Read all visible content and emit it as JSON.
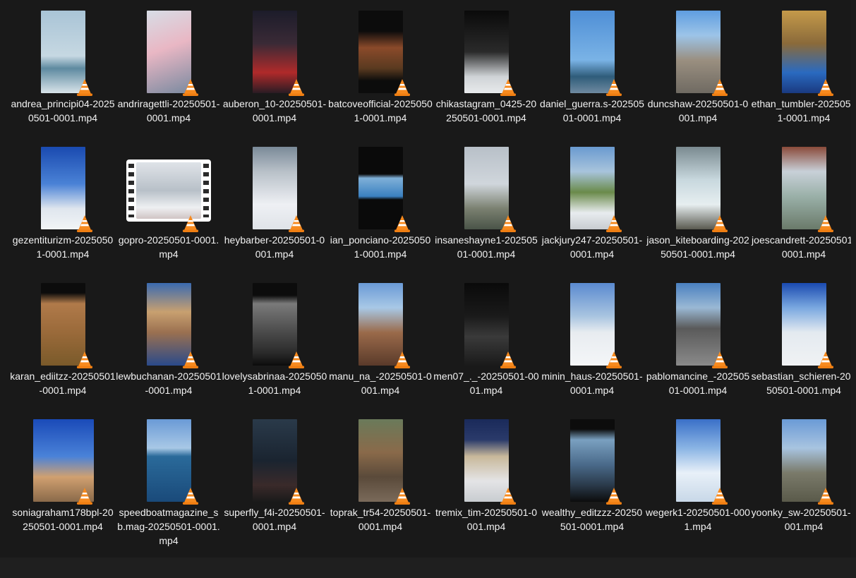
{
  "files": [
    {
      "name": "andrea_principi04-20250501-0001.mp4",
      "bg": "linear-gradient(180deg,#a9c4d6 0%,#c6d8e2 55%,#5e8aa0 70%,#d9e4ea 100%)"
    },
    {
      "name": "andriragettli-20250501-0001.mp4",
      "bg": "linear-gradient(160deg,#d7dde6 0%,#e9b7c4 45%,#7a8aa0 100%)"
    },
    {
      "name": "auberon_10-20250501-0001.mp4",
      "bg": "linear-gradient(180deg,#1c1c2a 0%,#3a2a36 40%,#b02a2a 75%,#2a1c24 100%)"
    },
    {
      "name": "batcoveofficial-20250501-0001.mp4",
      "bg": "linear-gradient(180deg,#0c0c0c 0%,#0c0c0c 25%,#8a4a2a 45%,#5a3a20 70%,#0c0c0c 85%)"
    },
    {
      "name": "chikastagram_0425-20250501-0001.mp4",
      "bg": "linear-gradient(180deg,#0a0a0a 0%,#2a2a2a 50%,#cfd3d6 80%,#e8eaec 100%)"
    },
    {
      "name": "daniel_guerra.s-20250501-0001.mp4",
      "bg": "linear-gradient(180deg,#4f8fd6 0%,#7ab3e6 60%,#2f5c7a 80%,#6f8aa0 100%)"
    },
    {
      "name": "duncshaw-20250501-0001.mp4",
      "bg": "linear-gradient(180deg,#5f9de0 0%,#9cc4e8 30%,#9a8f80 60%,#6f6a62 100%)"
    },
    {
      "name": "ethan_tumbler-20250501-0001.mp4",
      "bg": "linear-gradient(180deg,#c59a4a 0%,#8a6a3a 40%,#2a6ac0 75%,#1a3a80 100%)"
    },
    {
      "name": "gezentiturizm-20250501-0001.mp4",
      "bg": "linear-gradient(180deg,#1a4ab0 0%,#4a82d6 45%,#dfe6ee 75%,#f2f4f6 100%)"
    },
    {
      "name": "gopro-20250501-0001.mp4",
      "bg": "linear-gradient(180deg,#dfe3e8 0%,#b8c0c8 50%,#eef0f2 80%,#d0c4c4 100%)",
      "film": true
    },
    {
      "name": "heybarber-20250501-0001.mp4",
      "bg": "linear-gradient(180deg,#7a8a98 0%,#b8c0c8 30%,#eef0f4 70%,#dfe3e8 100%)"
    },
    {
      "name": "ian_ponciano-20250501-0001.mp4",
      "bg": "linear-gradient(180deg,#0a0a0a 0%,#0a0a0a 33%,#7fb0d8 38%,#3a80c0 60%,#0a0a0a 64%,#0a0a0a 100%)"
    },
    {
      "name": "insaneshayne1-20250501-0001.mp4",
      "bg": "linear-gradient(180deg,#b8c0c8 0%,#d0d6dc 45%,#7a8070 75%,#4a5448 100%)"
    },
    {
      "name": "jackjury247-20250501-0001.mp4",
      "bg": "linear-gradient(180deg,#6a9ad0 0%,#a8c4dc 30%,#6a8a4a 55%,#e8ecef 80%,#c8ccd0 100%)"
    },
    {
      "name": "jason_kiteboarding-20250501-0001.mp4",
      "bg": "linear-gradient(180deg,#7a8a90 0%,#c8d8de 40%,#e6eef0 70%,#5a5a50 100%)"
    },
    {
      "name": "joescandrett-20250501-0001.mp4",
      "bg": "linear-gradient(180deg,#8a4a3a 0%,#c8d0d8 30%,#9ab0a8 60%,#6a7a6a 100%)"
    },
    {
      "name": "karan_ediitzz-20250501-0001.mp4",
      "bg": "linear-gradient(180deg,#0c0c0c 0%,#0c0c0c 12%,#b07a4a 25%,#9a6a3a 60%,#7a5a2a 100%)"
    },
    {
      "name": "lewbuchanan-20250501-0001.mp4",
      "bg": "linear-gradient(180deg,#3a6ab0 0%,#c8a070 35%,#9a7050 60%,#2a4a8a 100%)"
    },
    {
      "name": "lovelysabrinaa-20250501-0001.mp4",
      "bg": "linear-gradient(180deg,#0c0c0c 0%,#0c0c0c 15%,#7a7a7a 25%,#4a4a4a 60%,#2a2a2a 85%,#0c0c0c 100%)"
    },
    {
      "name": "manu_na_-20250501-0001.mp4",
      "bg": "linear-gradient(180deg,#6a9ad6 0%,#a8c8e6 30%,#9a6a4a 60%,#5a3a2a 100%)"
    },
    {
      "name": "men07_._-20250501-0001.mp4",
      "bg": "linear-gradient(180deg,#0a0a0a 0%,#1a1a1a 40%,#3a3a3a 65%,#1a1a1a 100%)"
    },
    {
      "name": "minin_haus-20250501-0001.mp4",
      "bg": "linear-gradient(180deg,#5a8ad0 0%,#a8c4e0 40%,#e8ecf0 60%,#f4f6f8 100%)"
    },
    {
      "name": "pablomancine_-20250501-0001.mp4",
      "bg": "linear-gradient(180deg,#4a80c0 0%,#9ab8d4 30%,#5a5a5a 55%,#8a8a8a 100%)"
    },
    {
      "name": "sebastian_schieren-20250501-0001.mp4",
      "bg": "linear-gradient(180deg,#1a4ab0 0%,#7aa8e0 30%,#e4eaf0 60%,#f0f2f4 100%)"
    },
    {
      "name": "soniagraham178bpl-20250501-0001.mp4",
      "bg": "linear-gradient(180deg,#1a4ab8 0%,#4a82d8 45%,#d0a070 70%,#8a6a4a 100%)",
      "wide": true
    },
    {
      "name": "speedboatmagazine_sb.mag-20250501-0001.mp4",
      "bg": "linear-gradient(180deg,#6a9ad6 0%,#a8c8e6 35%,#2a6a9a 45%,#1a4a7a 100%)"
    },
    {
      "name": "superfly_f4i-20250501-0001.mp4",
      "bg": "linear-gradient(180deg,#2a3a4a 0%,#1a2430 50%,#3a2a2a 80%,#1a1a1a 100%)"
    },
    {
      "name": "toprak_tr54-20250501-0001.mp4",
      "bg": "linear-gradient(180deg,#6a7a5a 0%,#8a6a4a 40%,#5a4a3a 70%,#7a6a5a 100%)"
    },
    {
      "name": "tremix_tim-20250501-0001.mp4",
      "bg": "linear-gradient(180deg,#1a2a5a 0%,#2a3a6a 25%,#c8b89a 45%,#e4e4e6 75%,#c8ccd0 100%)"
    },
    {
      "name": "wealthy_editzzz-20250501-0001.mp4",
      "bg": "linear-gradient(180deg,#0c0c0c 0%,#0c0c0c 12%,#7aa0c0 25%,#4a6a8a 55%,#2a3a4a 80%,#0c0c0c 100%)"
    },
    {
      "name": "wegerk1-20250501-0001.mp4",
      "bg": "linear-gradient(180deg,#3a70c8 0%,#8ab4e4 35%,#e8f0f8 65%,#c8d8e8 100%)"
    },
    {
      "name": "yoonky_sw-20250501-0001.mp4",
      "bg": "linear-gradient(180deg,#6a9ad6 0%,#a8c4e0 35%,#7a7a6a 65%,#5a5a4a 100%)"
    }
  ]
}
